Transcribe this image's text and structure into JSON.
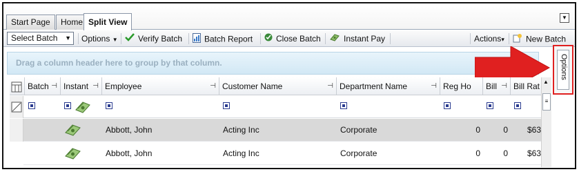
{
  "tabs": [
    {
      "label": "Start Page"
    },
    {
      "label": "Home"
    },
    {
      "label": "Split View"
    }
  ],
  "toolbar": {
    "select_label": "Select Batch",
    "options_label": "Options",
    "verify_label": "Verify Batch",
    "report_label": "Batch Report",
    "close_label": "Close Batch",
    "instant_label": "Instant Pay",
    "actions_label": "Actions",
    "new_batch_label": "New Batch"
  },
  "group_panel": {
    "text": "Drag a column header here to group by that column."
  },
  "options_tab": {
    "label": "Options"
  },
  "grid": {
    "columns": [
      "Batch",
      "Instant",
      "Employee",
      "Customer Name",
      "Department Name",
      "Reg Ho",
      "Bill",
      "Bill Rat"
    ],
    "rows": [
      {
        "employee": "Abbott, John",
        "customer": "Acting Inc",
        "department": "Corporate",
        "reg": "0",
        "bill": "0",
        "rate": "$63"
      },
      {
        "employee": "Abbott, John",
        "customer": "Acting Inc",
        "department": "Corporate",
        "reg": "0",
        "bill": "0",
        "rate": "$63"
      }
    ]
  },
  "colors": {
    "accent_red": "#e02020",
    "group_panel_text": "#9ab0c0",
    "selected_row": "#d9d9d9"
  },
  "icons": {
    "select_arrow": "▼",
    "options_arrow": "▼",
    "actions_arrow": "▾",
    "pin": "⊣"
  }
}
